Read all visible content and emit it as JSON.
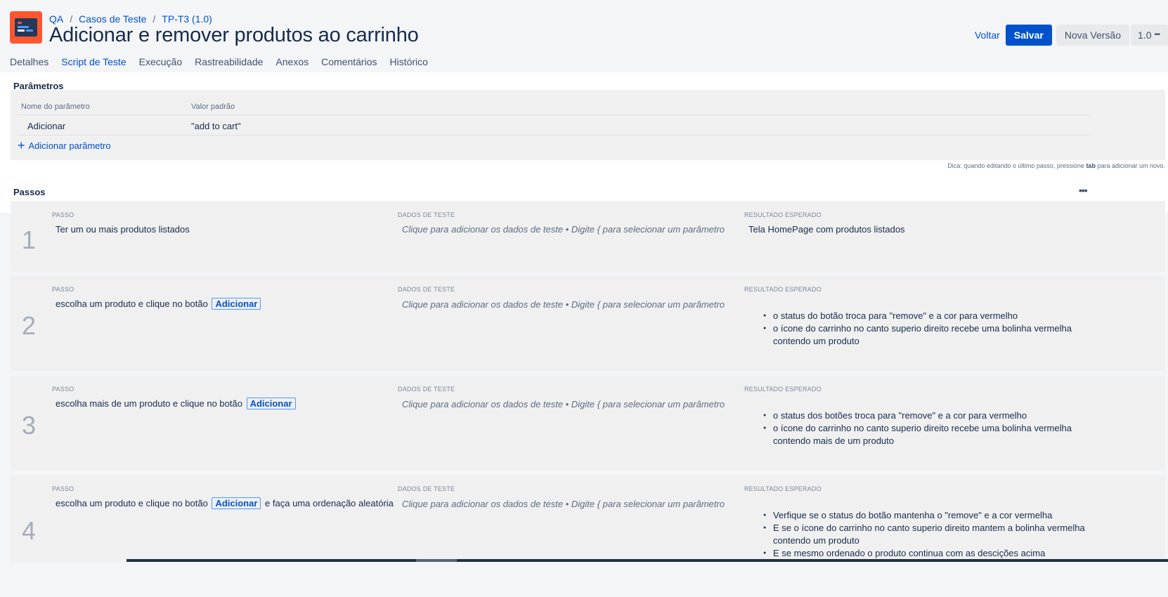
{
  "breadcrumb": [
    "QA",
    "Casos de Teste",
    "TP-T3 (1.0)"
  ],
  "title": "Adicionar e remover produtos ao carrinho",
  "actions": {
    "back": "Voltar",
    "save": "Salvar",
    "new_version": "Nova Versão",
    "version": "1.0",
    "more": "•••"
  },
  "tabs": [
    "Detalhes",
    "Script de Teste",
    "Execução",
    "Rastreabilidade",
    "Anexos",
    "Comentários",
    "Histórico"
  ],
  "active_tab": "Script de Teste",
  "parameters": {
    "title": "Parâmetros",
    "columns": [
      "Nome do parâmetro",
      "Valor padrão"
    ],
    "rows": [
      {
        "name": "Adicionar",
        "value": "\"add to cart\""
      }
    ],
    "add_label": "Adicionar parâmetro"
  },
  "tip": {
    "before": "Dica: quando editando o último passo, pressione ",
    "key": "tab",
    "after": " para adicionar um novo."
  },
  "steps": {
    "title": "Passos",
    "more": "•••",
    "labels": {
      "step": "PASSO",
      "test_data": "DADOS DE TESTE",
      "expected": "RESULTADO ESPERADO"
    },
    "placeholder": "Clique para adicionar os dados de teste • Digite { para selecionar um parâmetro",
    "items": [
      {
        "num": "1",
        "step_text": "Ter um ou mais produtos listados",
        "expected_text": "Tela HomePage com produtos listados"
      },
      {
        "num": "2",
        "step_text": "escolha um produto e clique no botão",
        "step_param": "Adicionar",
        "expected": [
          "o status do botão troca para \"remove\" e a cor  para vermelho",
          "o ícone do carrinho no canto superio direito recebe uma bolinha vermelha",
          "contendo um produto"
        ]
      },
      {
        "num": "3",
        "step_text": "escolha mais de um produto e clique no botão",
        "step_param": "Adicionar",
        "expected": [
          " o status dos botões troca para \"remove\" e a cor  para vermelho",
          "o ícone do carrinho no canto superio direito recebe uma bolinha vermelha",
          "contendo mais de um produto"
        ]
      },
      {
        "num": "4",
        "step_text": "escolha um produto e clique no botão",
        "step_param": "Adicionar",
        "step_after": "e faça uma ordenação aleatória",
        "expected": [
          "Verfique se o status do botão mantenha o \"remove\" e a cor vermelha",
          "E se o ícone do carrinho no canto superio direito mantem a bolinha vermelha",
          "contendo um produto",
          "E se mesmo ordenado o produto continua com as descições acima"
        ]
      }
    ]
  }
}
